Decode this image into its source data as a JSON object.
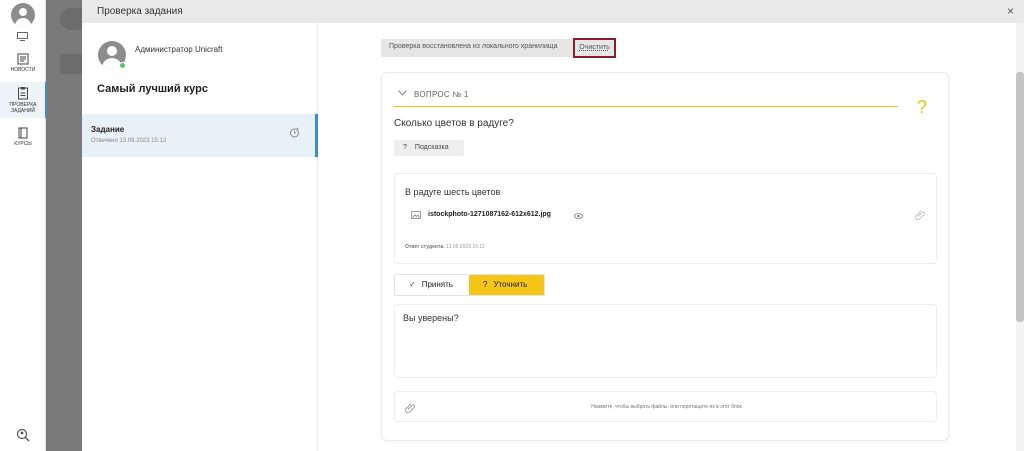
{
  "rail": {
    "items": [
      {
        "label": "НОВОСТИ",
        "icon": "news-icon"
      },
      {
        "label": "ПРОВЕРКА ЗАДАНИЙ",
        "icon": "task-review-icon"
      },
      {
        "label": "КУРСЫ",
        "icon": "courses-icon"
      }
    ],
    "top_icon": "monitor-icon",
    "bottom_icon": "search-person-icon"
  },
  "modal": {
    "title": "Проверка задания",
    "close_label": "×"
  },
  "sidebar": {
    "user_name": "Администратор Unicraft",
    "course_title": "Самый лучший курс",
    "task": {
      "name": "Задание",
      "date": "Отвечено 13.09.2023 15:12"
    }
  },
  "restore": {
    "message": "Проверка восстановлена из локального хранилища",
    "clear_label": "Очистить"
  },
  "question": {
    "label": "ВОПРОС № 1",
    "mark": "?",
    "text": "Сколько цветов в радуге?",
    "hint_label": "Подсказка",
    "hint_icon": "?"
  },
  "answer": {
    "text": "В радуге шесть цветов",
    "file_name": "istockphoto-1271087162-612x612.jpg",
    "meta_label": "Ответ студента.",
    "meta_date": "13.09.2023 15:12"
  },
  "actions": {
    "accept_label": "Принять",
    "accept_icon": "✓",
    "clarify_label": "Уточнить",
    "clarify_icon": "?"
  },
  "comment": {
    "text": "Вы уверены?"
  },
  "dropzone": {
    "text": "Нажмите, чтобы выбрать файлы, или перетащите их в этот блок"
  },
  "colors": {
    "accent_yellow": "#f5c518",
    "active_blue": "#3d8ad8",
    "highlight_border": "#8b1c2a"
  }
}
